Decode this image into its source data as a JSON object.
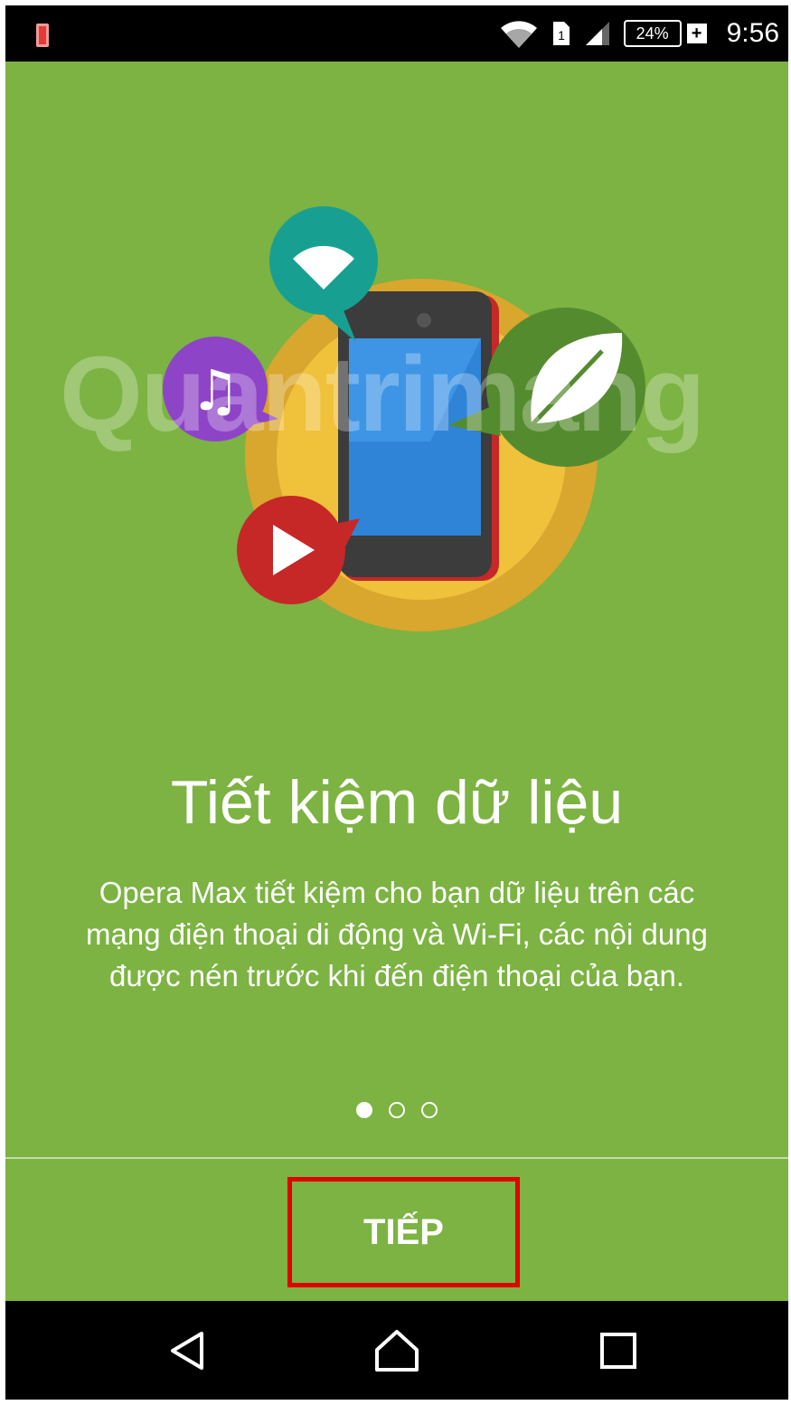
{
  "status_bar": {
    "battery_level": "24%",
    "time": "9:56",
    "sim_slot": "1",
    "icons": [
      "notification-icon",
      "wifi-icon",
      "sim-icon",
      "signal-icon",
      "battery-icon",
      "charging-icon"
    ]
  },
  "watermark": "Quantrimang",
  "onboarding": {
    "title": "Tiết kiệm dữ liệu",
    "description": "Opera Max tiết kiệm cho bạn dữ liệu trên các mạng điện thoại di động và Wi-Fi, các nội dung được nén trước khi đến điện thoại của bạn.",
    "page_indicator": {
      "current": 1,
      "total": 3
    },
    "next_label": "TIẾP"
  },
  "nav_bar": {
    "icons": [
      "back-icon",
      "home-icon",
      "recent-apps-icon"
    ]
  },
  "colors": {
    "background": "#7cb342",
    "status_bar": "#000000",
    "highlight": "#e00000",
    "orange_circle": "#f0c13a",
    "wifi_bubble": "#17a092",
    "music_bubble": "#8e44c7",
    "video_bubble": "#c62828",
    "leaf_bubble": "#558b2f",
    "phone_screen": "#2f84d8"
  }
}
